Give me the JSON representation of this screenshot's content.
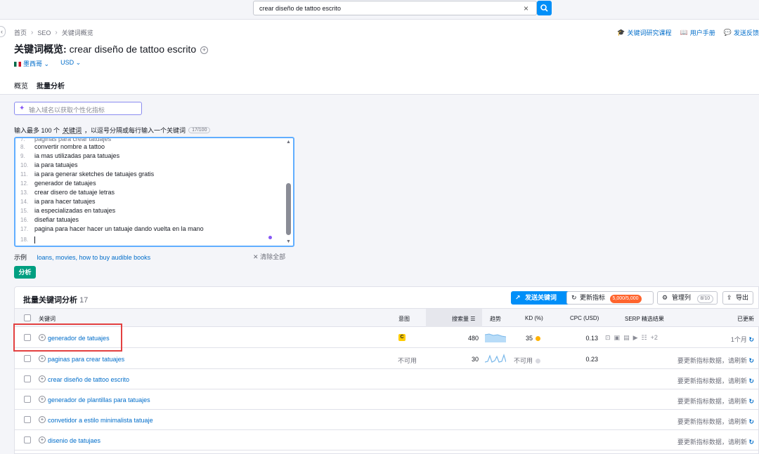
{
  "search": {
    "value": "crear diseño de tattoo escrito"
  },
  "breadcrumb": [
    "首页",
    "SEO",
    "关键词概览"
  ],
  "top_links": [
    "关键词研究课程",
    "用户手册",
    "发送反馈"
  ],
  "title": {
    "prefix": "关键词概览:",
    "keyword": "crear diseño de tattoo escrito"
  },
  "country": "墨西哥",
  "currency": "USD",
  "tabs": [
    "概览",
    "批量分析"
  ],
  "domain_placeholder": "输入域名以获取个性化指标",
  "instructions": {
    "text_before": "输入最多 100 个",
    "link": "关键词",
    "text_after": "，以逗号分隔或每行输入一个关键词",
    "count": "17/100"
  },
  "textarea_lines": [
    {
      "num": "8.",
      "text": "convertir nombre a tattoo"
    },
    {
      "num": "9.",
      "text": "ia mas utilizadas para tatuajes"
    },
    {
      "num": "10.",
      "text": "ia para tatuajes"
    },
    {
      "num": "11.",
      "text": "ia para generar sketches de tatuajes gratis"
    },
    {
      "num": "12.",
      "text": "generador de tatuajes"
    },
    {
      "num": "13.",
      "text": "crear disero de tatuaje letras"
    },
    {
      "num": "14.",
      "text": "ia para hacer tatuajes"
    },
    {
      "num": "15.",
      "text": "ia especializadas en tatuajes"
    },
    {
      "num": "16.",
      "text": "disefiar tatuajes"
    },
    {
      "num": "17.",
      "text": "pagina para hacer hacer un tatuaje dando vuelta en la mano"
    },
    {
      "num": "18.",
      "text": ""
    }
  ],
  "examples": {
    "label": "示例",
    "links": "loans, movies, how to buy audible books",
    "clear": "清除全部"
  },
  "analyze_label": "分析",
  "panel": {
    "title": "批量关键词分析",
    "count": "17",
    "send_label": "发送关键词",
    "update_label": "更新指标",
    "update_badge": "5,000/5,000",
    "manage_label": "管理列",
    "manage_badge": "8/10",
    "export_label": "导出"
  },
  "columns": {
    "keyword": "关键词",
    "intent": "意图",
    "volume": "搜索量",
    "trend": "趋势",
    "kd": "KD (%)",
    "cpc": "CPC (USD)",
    "serp": "SERP 精选结果",
    "updated": "已更新"
  },
  "rows": [
    {
      "keyword": "generador de tatuajes",
      "intent": "C",
      "volume": "480",
      "kd": "35",
      "kd_color": "#ffb200",
      "cpc": "0.13",
      "serp_more": "+2",
      "updated": "1个月"
    },
    {
      "keyword": "paginas para crear tatuajes",
      "intent": "不可用",
      "volume": "30",
      "kd": "不可用",
      "kd_color": "#d8d9e0",
      "cpc": "0.23",
      "updated": "要更新指标数据，请刷新"
    },
    {
      "keyword": "crear diseño de tattoo escrito",
      "updated": "要更新指标数据，请刷新"
    },
    {
      "keyword": "generador de plantillas para tatuajes",
      "updated": "要更新指标数据，请刷新"
    },
    {
      "keyword": "convetidor a estilo minimalista tatuaje",
      "updated": "要更新指标数据，请刷新"
    },
    {
      "keyword": "disenio de tatujaes",
      "updated": "要更新指标数据，请刷新"
    }
  ],
  "colors": {
    "accent": "#008ff8",
    "green": "#009f81",
    "orange": "#ff642d",
    "highlight": "#e34040"
  }
}
